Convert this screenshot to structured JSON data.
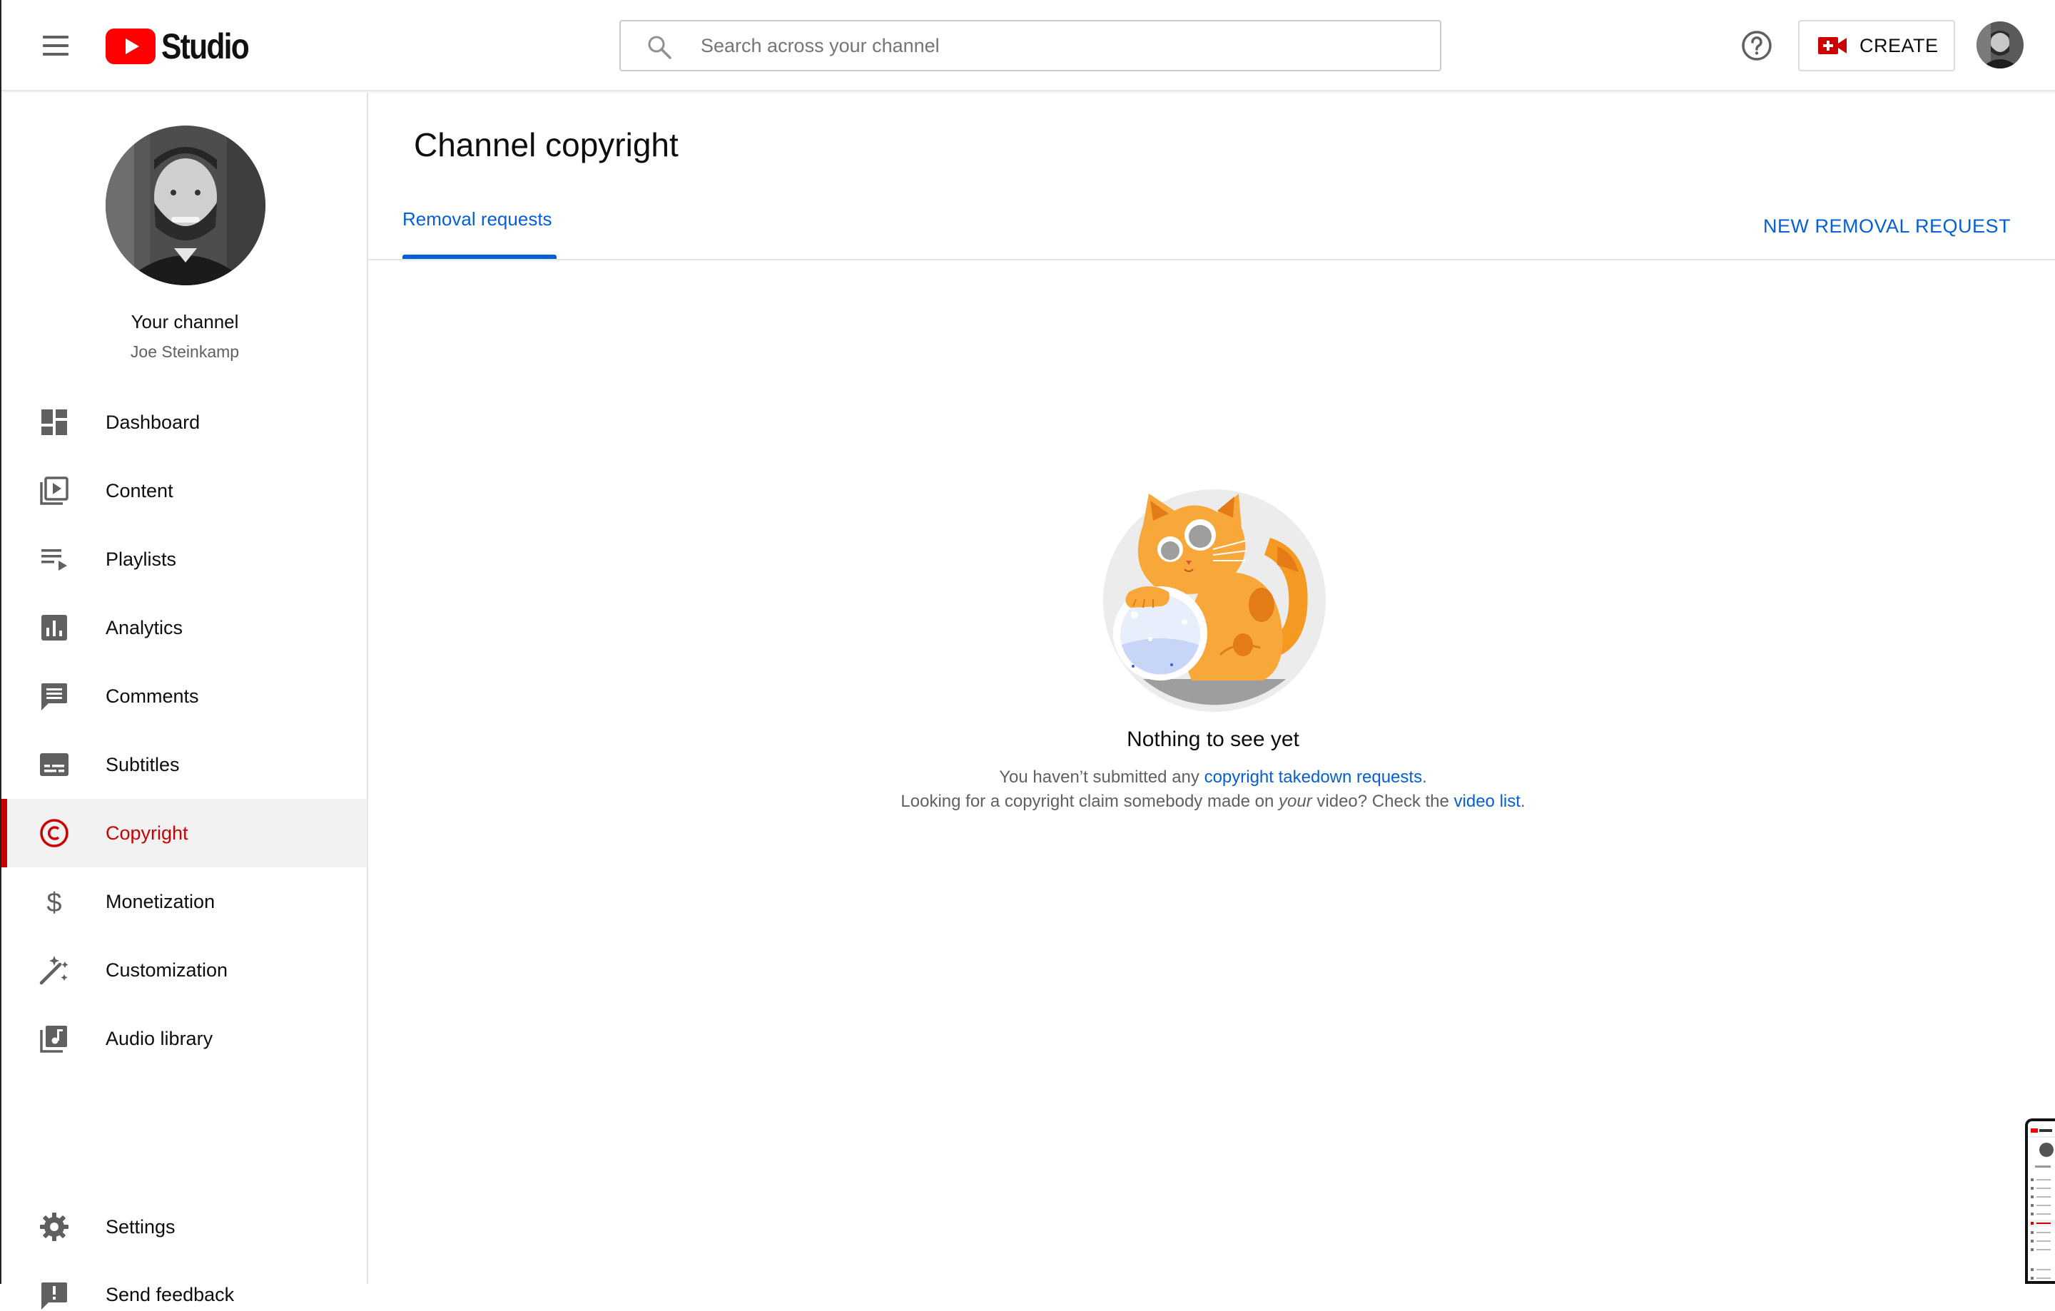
{
  "header": {
    "logo_text": "Studio",
    "search_placeholder": "Search across your channel",
    "create_label": "CREATE"
  },
  "sidebar": {
    "your_channel": "Your channel",
    "channel_name": "Joe Steinkamp",
    "items": [
      {
        "label": "Dashboard",
        "icon": "dashboard-icon"
      },
      {
        "label": "Content",
        "icon": "content-icon"
      },
      {
        "label": "Playlists",
        "icon": "playlists-icon"
      },
      {
        "label": "Analytics",
        "icon": "analytics-icon"
      },
      {
        "label": "Comments",
        "icon": "comments-icon"
      },
      {
        "label": "Subtitles",
        "icon": "subtitles-icon"
      },
      {
        "label": "Copyright",
        "icon": "copyright-icon",
        "active": true
      },
      {
        "label": "Monetization",
        "icon": "dollar-icon"
      },
      {
        "label": "Customization",
        "icon": "magic-wand-icon"
      },
      {
        "label": "Audio library",
        "icon": "audio-library-icon"
      }
    ],
    "footer_items": [
      {
        "label": "Settings",
        "icon": "gear-icon"
      },
      {
        "label": "Send feedback",
        "icon": "feedback-icon"
      }
    ]
  },
  "main": {
    "title": "Channel copyright",
    "tab_label": "Removal requests",
    "new_request_label": "NEW REMOVAL REQUEST",
    "empty_state": {
      "title": "Nothing to see yet",
      "line1_prefix": "You haven’t submitted any ",
      "line1_link": "copyright takedown requests",
      "line1_suffix": ".",
      "line2_prefix": "Looking for a copyright claim somebody made on ",
      "line2_emphasis": "your",
      "line2_middle": " video? Check the ",
      "line2_link": "video list",
      "line2_suffix": "."
    }
  },
  "colors": {
    "accent_blue": "#065fd4",
    "active_red": "#cc0000",
    "icon_gray": "#606060"
  }
}
